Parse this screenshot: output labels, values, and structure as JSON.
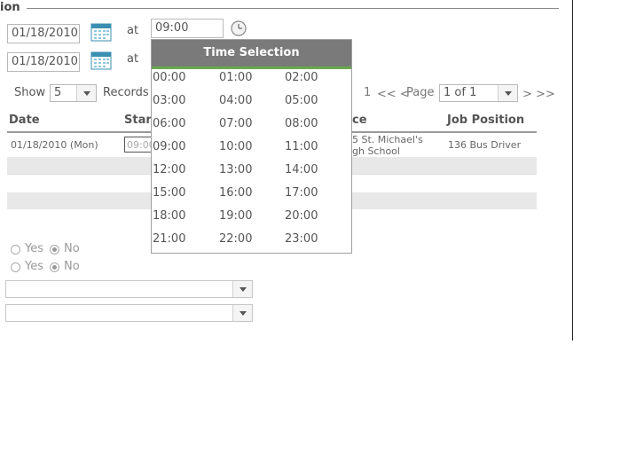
{
  "section": {
    "title": "ion"
  },
  "start": {
    "date": "01/18/2010",
    "at_label": "at",
    "time": "09:00"
  },
  "end": {
    "date": "01/18/2010",
    "at_label": "at"
  },
  "records": {
    "show_label": "Show",
    "page_size": "5",
    "records_label": "Records"
  },
  "pager": {
    "current": "1",
    "first_prev": "<< <",
    "page_label": "Page",
    "page_value": "1 of 1",
    "next_last": "> >>"
  },
  "table": {
    "headers": {
      "date": "Date",
      "start": "Star",
      "place": "ce",
      "job": "Job Position"
    },
    "rows": [
      {
        "date": "01/18/2010 (Mon)",
        "start": "09:00",
        "place_line1": "5 St. Michael's",
        "place_line2": "gh School",
        "job": "136 Bus Driver"
      }
    ]
  },
  "radios": [
    {
      "yes": "Yes",
      "no": "No",
      "selected": "No"
    },
    {
      "yes": "Yes",
      "no": "No",
      "selected": "No"
    }
  ],
  "time_popup": {
    "title": "Time Selection",
    "slots": [
      "00:00",
      "01:00",
      "02:00",
      "03:00",
      "04:00",
      "05:00",
      "06:00",
      "07:00",
      "08:00",
      "09:00",
      "10:00",
      "11:00",
      "12:00",
      "13:00",
      "14:00",
      "15:00",
      "16:00",
      "17:00",
      "18:00",
      "19:00",
      "20:00",
      "21:00",
      "22:00",
      "23:00"
    ]
  },
  "colors": {
    "popup_header": "#7a7a7a",
    "popup_accent": "#6aa84f",
    "calendar_icon": "#3a8fb0"
  }
}
